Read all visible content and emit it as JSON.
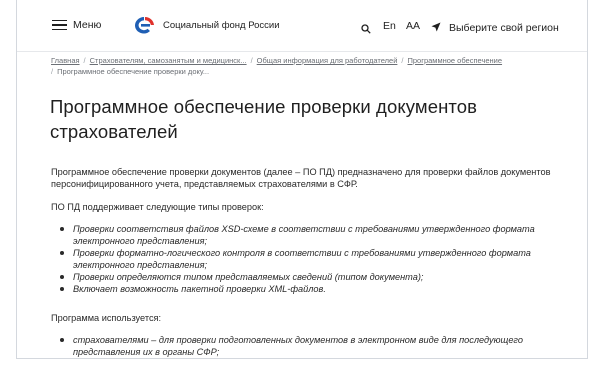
{
  "header": {
    "menu_label": "Меню",
    "logo_text": "Социальный фонд России",
    "lang_label": "En",
    "font_size_label": "AA",
    "region_label": "Выберите свой регион",
    "colors": {
      "logo_blue": "#1f5fb4",
      "logo_red": "#e0312b"
    }
  },
  "breadcrumb": {
    "items": [
      "Главная",
      "Страхователям, самозанятым и медицинск...",
      "Общая информация для работодателей",
      "Программное обеспечение",
      "Программное обеспечение проверки доку..."
    ]
  },
  "page": {
    "title": "Программное обеспечение проверки документов страхователей",
    "intro": "Программное обеспечение проверки документов (далее – ПО ПД) предназначено для проверки файлов документов персонифицированного учета, представляемых  страхователями в СФР.",
    "supports_label": "ПО ПД поддерживает следующие типы проверок:",
    "checks": [
      "Проверки соответствия файлов XSD-схеме в соответствии с требованиями утвержденного формата электронного представления;",
      "Проверки форматно-логического контроля в соответствии с требованиями утвержденного формата электронного представления;",
      "Проверки определяются типом представляемых сведений (типом документа);",
      "Включает возможность пакетной проверки XML-файлов."
    ],
    "used_label": "Программа используется:",
    "uses": [
      "страхователями – для проверки подготовленных документов в электронном виде для последующего представления их в органы СФР;"
    ]
  }
}
